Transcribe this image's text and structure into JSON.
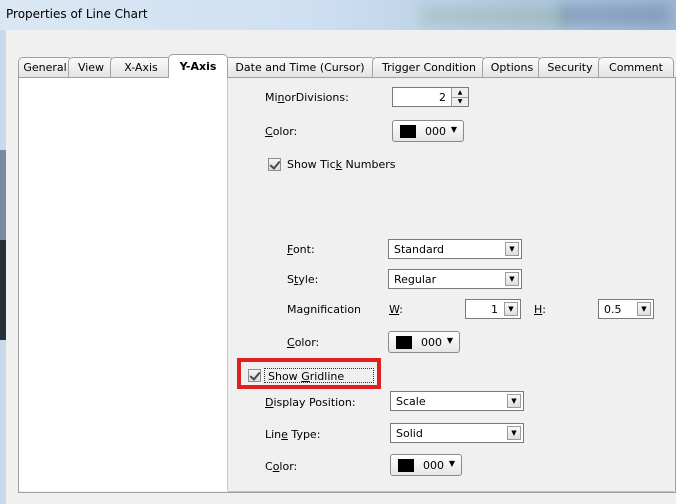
{
  "window": {
    "title": "Properties of Line Chart"
  },
  "tabs": [
    {
      "label": "General",
      "active": false
    },
    {
      "label": "View",
      "active": false
    },
    {
      "label": "X-Axis",
      "active": false
    },
    {
      "label": "Y-Axis",
      "active": true
    },
    {
      "label": "Date and Time (Cursor)",
      "active": false
    },
    {
      "label": "Trigger Condition",
      "active": false
    },
    {
      "label": "Options",
      "active": false
    },
    {
      "label": "Security",
      "active": false
    },
    {
      "label": "Comment",
      "active": false
    }
  ],
  "yaxis": {
    "minor_divisions": {
      "pre": "Mi",
      "key": "n",
      "post": "orDivisions:",
      "value": "2"
    },
    "color1": {
      "pre": "",
      "key": "C",
      "post": "olor:",
      "value": "000"
    },
    "show_tick_numbers": {
      "pre": "Show Tic",
      "key": "k",
      "post": " Numbers",
      "checked": true
    },
    "font": {
      "pre": "",
      "key": "F",
      "post": "ont:",
      "value": "Standard"
    },
    "style": {
      "pre": "S",
      "key": "t",
      "post": "yle:",
      "value": "Regular"
    },
    "magnification": {
      "label": "Magnification",
      "w": {
        "pre": "",
        "key": "W",
        "post": ":",
        "value": "1"
      },
      "h": {
        "pre": "",
        "key": "H",
        "post": ":",
        "value": "0.5"
      }
    },
    "color2": {
      "pre": "",
      "key": "C",
      "post": "olor:",
      "value": "000"
    },
    "show_gridline": {
      "pre": "Show ",
      "key": "G",
      "post": "ridline",
      "checked": true
    },
    "display_position": {
      "pre": "",
      "key": "D",
      "post": "isplay Position:",
      "value": "Scale"
    },
    "line_type": {
      "pre": "Lin",
      "key": "e",
      "post": " Type:",
      "value": "Solid"
    },
    "color3": {
      "pre": "C",
      "key": "o",
      "post": "lor:",
      "value": "000"
    }
  },
  "colors": {
    "highlight": "#e0201e",
    "swatch": "#000000"
  }
}
